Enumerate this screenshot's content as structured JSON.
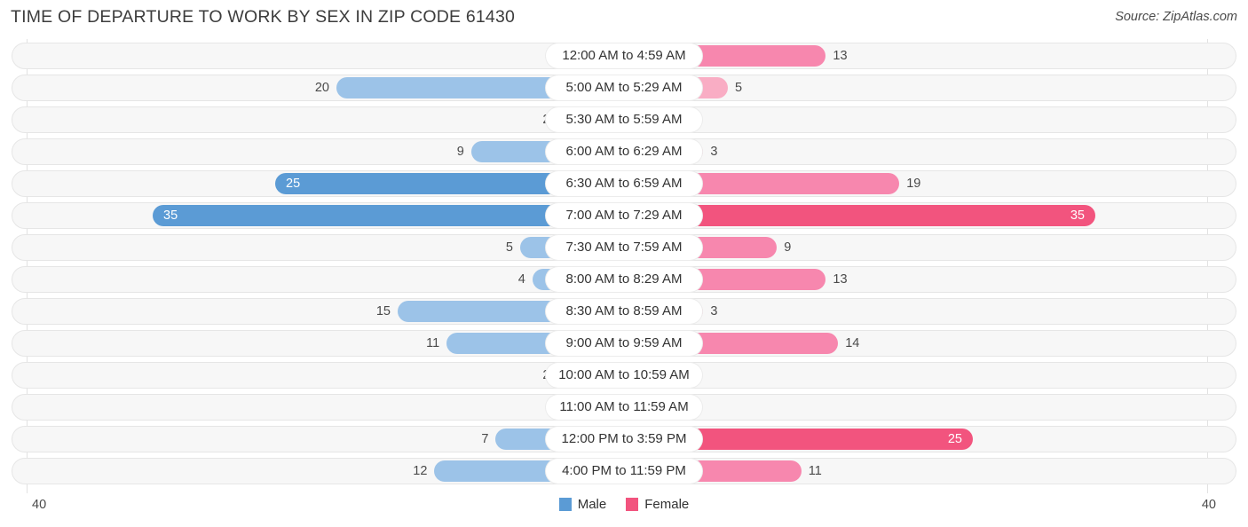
{
  "header": {
    "title": "TIME OF DEPARTURE TO WORK BY SEX IN ZIP CODE 61430",
    "source": "Source: ZipAtlas.com"
  },
  "legend": {
    "male_label": "Male",
    "female_label": "Female",
    "male_color": "#5B9BD5",
    "female_color": "#F2547E"
  },
  "axis": {
    "left_cap": "40",
    "right_cap": "40"
  },
  "colors": {
    "male_light": "#9CC3E8",
    "male_strong": "#5B9BD5",
    "female_light": "#F9ADC4",
    "female_mid": "#F787AE",
    "female_strong": "#F2547E",
    "track": "#F7F7F7",
    "track_border": "#E6E6E6"
  },
  "chart_data": {
    "type": "bar",
    "orientation": "horizontal",
    "layout": "diverging-bidirectional",
    "title": "TIME OF DEPARTURE TO WORK BY SEX IN ZIP CODE 61430",
    "xlabel": "",
    "ylabel": "",
    "xlim": [
      40,
      40
    ],
    "axis_max": 40,
    "grid": false,
    "legend_position": "bottom-center",
    "categories": [
      "12:00 AM to 4:59 AM",
      "5:00 AM to 5:29 AM",
      "5:30 AM to 5:59 AM",
      "6:00 AM to 6:29 AM",
      "6:30 AM to 6:59 AM",
      "7:00 AM to 7:29 AM",
      "7:30 AM to 7:59 AM",
      "8:00 AM to 8:29 AM",
      "8:30 AM to 8:59 AM",
      "9:00 AM to 9:59 AM",
      "10:00 AM to 10:59 AM",
      "11:00 AM to 11:59 AM",
      "12:00 PM to 3:59 PM",
      "4:00 PM to 11:59 PM"
    ],
    "series": [
      {
        "name": "Male",
        "values": [
          0,
          20,
          2,
          9,
          25,
          35,
          5,
          4,
          15,
          11,
          2,
          0,
          7,
          12
        ]
      },
      {
        "name": "Female",
        "values": [
          13,
          5,
          0,
          3,
          19,
          35,
          9,
          13,
          3,
          14,
          0,
          0,
          25,
          11
        ]
      }
    ]
  },
  "rows": [
    {
      "label": "12:00 AM to 4:59 AM",
      "male": "0",
      "female": "13"
    },
    {
      "label": "5:00 AM to 5:29 AM",
      "male": "20",
      "female": "5"
    },
    {
      "label": "5:30 AM to 5:59 AM",
      "male": "2",
      "female": "0"
    },
    {
      "label": "6:00 AM to 6:29 AM",
      "male": "9",
      "female": "3"
    },
    {
      "label": "6:30 AM to 6:59 AM",
      "male": "25",
      "female": "19"
    },
    {
      "label": "7:00 AM to 7:29 AM",
      "male": "35",
      "female": "35"
    },
    {
      "label": "7:30 AM to 7:59 AM",
      "male": "5",
      "female": "9"
    },
    {
      "label": "8:00 AM to 8:29 AM",
      "male": "4",
      "female": "13"
    },
    {
      "label": "8:30 AM to 8:59 AM",
      "male": "15",
      "female": "3"
    },
    {
      "label": "9:00 AM to 9:59 AM",
      "male": "11",
      "female": "14"
    },
    {
      "label": "10:00 AM to 10:59 AM",
      "male": "2",
      "female": "0"
    },
    {
      "label": "11:00 AM to 11:59 AM",
      "male": "0",
      "female": "0"
    },
    {
      "label": "12:00 PM to 3:59 PM",
      "male": "7",
      "female": "25"
    },
    {
      "label": "4:00 PM to 11:59 PM",
      "male": "12",
      "female": "11"
    }
  ]
}
